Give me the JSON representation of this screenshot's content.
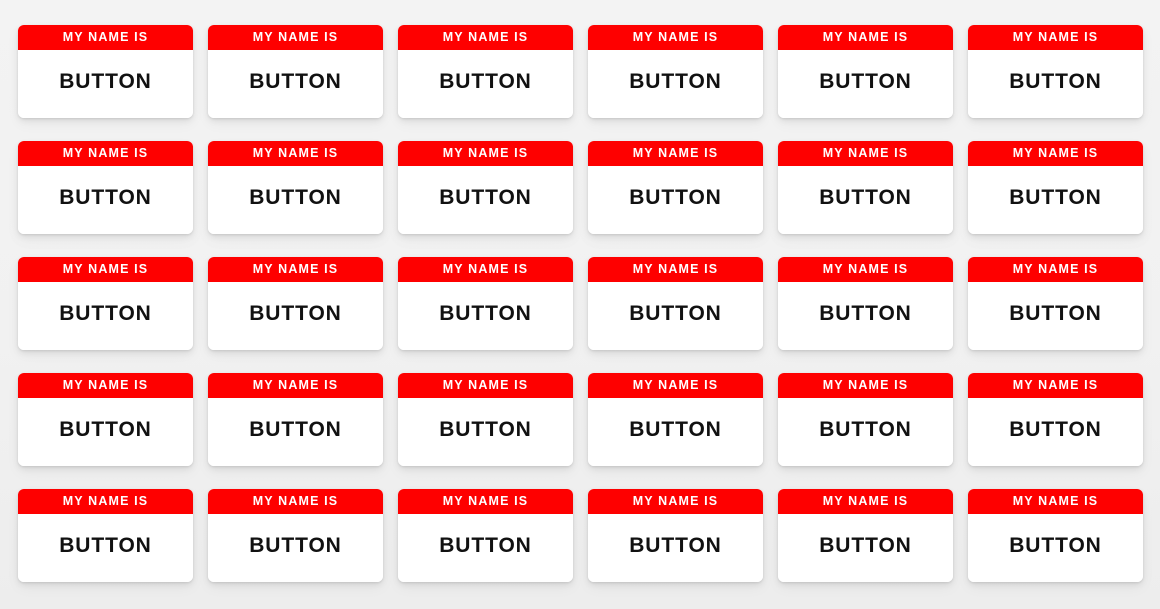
{
  "page": {
    "background_color": "#f1f1f1",
    "columns": 6,
    "rows": 5,
    "total_badges": 30
  },
  "badge_template": {
    "header_label": "MY NAME IS",
    "name_label": "BUTTON",
    "header_color": "#fe0000",
    "header_text_color": "#ffffff",
    "body_color": "#ffffff",
    "name_text_color": "#111111"
  },
  "badges": [
    {
      "header_label": "MY NAME IS",
      "name_label": "BUTTON"
    },
    {
      "header_label": "MY NAME IS",
      "name_label": "BUTTON"
    },
    {
      "header_label": "MY NAME IS",
      "name_label": "BUTTON"
    },
    {
      "header_label": "MY NAME IS",
      "name_label": "BUTTON"
    },
    {
      "header_label": "MY NAME IS",
      "name_label": "BUTTON"
    },
    {
      "header_label": "MY NAME IS",
      "name_label": "BUTTON"
    },
    {
      "header_label": "MY NAME IS",
      "name_label": "BUTTON"
    },
    {
      "header_label": "MY NAME IS",
      "name_label": "BUTTON"
    },
    {
      "header_label": "MY NAME IS",
      "name_label": "BUTTON"
    },
    {
      "header_label": "MY NAME IS",
      "name_label": "BUTTON"
    },
    {
      "header_label": "MY NAME IS",
      "name_label": "BUTTON"
    },
    {
      "header_label": "MY NAME IS",
      "name_label": "BUTTON"
    },
    {
      "header_label": "MY NAME IS",
      "name_label": "BUTTON"
    },
    {
      "header_label": "MY NAME IS",
      "name_label": "BUTTON"
    },
    {
      "header_label": "MY NAME IS",
      "name_label": "BUTTON"
    },
    {
      "header_label": "MY NAME IS",
      "name_label": "BUTTON"
    },
    {
      "header_label": "MY NAME IS",
      "name_label": "BUTTON"
    },
    {
      "header_label": "MY NAME IS",
      "name_label": "BUTTON"
    },
    {
      "header_label": "MY NAME IS",
      "name_label": "BUTTON"
    },
    {
      "header_label": "MY NAME IS",
      "name_label": "BUTTON"
    },
    {
      "header_label": "MY NAME IS",
      "name_label": "BUTTON"
    },
    {
      "header_label": "MY NAME IS",
      "name_label": "BUTTON"
    },
    {
      "header_label": "MY NAME IS",
      "name_label": "BUTTON"
    },
    {
      "header_label": "MY NAME IS",
      "name_label": "BUTTON"
    },
    {
      "header_label": "MY NAME IS",
      "name_label": "BUTTON"
    },
    {
      "header_label": "MY NAME IS",
      "name_label": "BUTTON"
    },
    {
      "header_label": "MY NAME IS",
      "name_label": "BUTTON"
    },
    {
      "header_label": "MY NAME IS",
      "name_label": "BUTTON"
    },
    {
      "header_label": "MY NAME IS",
      "name_label": "BUTTON"
    },
    {
      "header_label": "MY NAME IS",
      "name_label": "BUTTON"
    }
  ]
}
